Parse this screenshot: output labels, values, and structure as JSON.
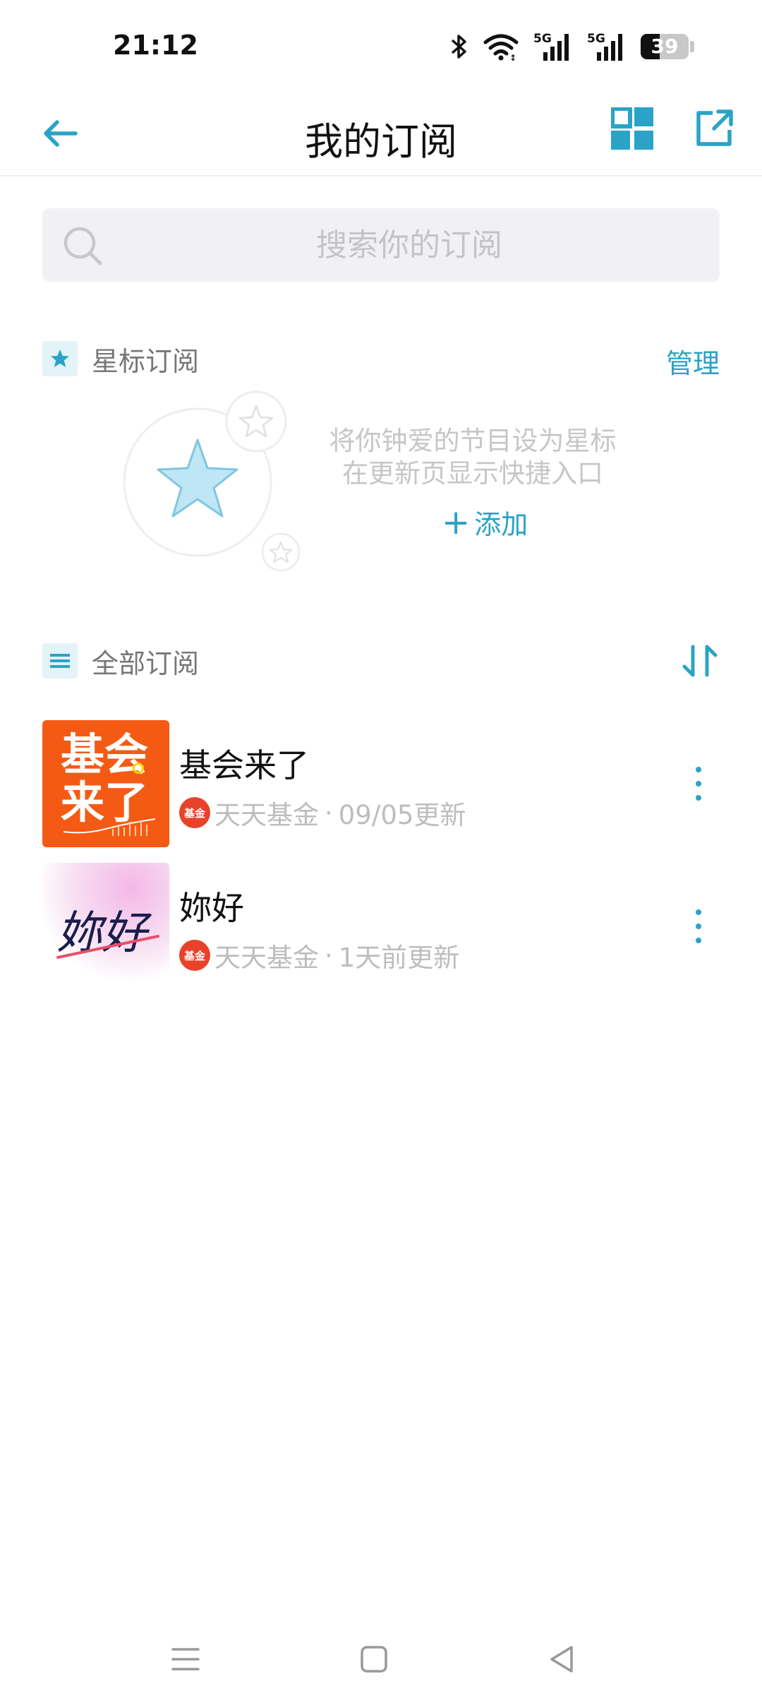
{
  "status_bar": {
    "time": "21:12",
    "network_1": "5G",
    "network_2": "5G",
    "battery_percent": 39,
    "battery_text": "39"
  },
  "header": {
    "title": "我的订阅",
    "back_icon": "arrow-left-icon",
    "grid_icon": "grid-view-icon",
    "share_icon": "external-link-icon"
  },
  "search": {
    "placeholder": "搜索你的订阅",
    "value": ""
  },
  "starred": {
    "title": "星标订阅",
    "action": "管理",
    "empty_line_1": "将你钟爱的节目设为星标",
    "empty_line_2": "在更新页显示快捷入口",
    "add_label": "添加",
    "add_symbol": "+"
  },
  "all": {
    "title": "全部订阅",
    "sort_icon": "sort-icon",
    "items": [
      {
        "title": "基会来了",
        "thumb_line_1": "基会",
        "thumb_line_2": "来了",
        "author_badge": "基金",
        "author": "天天基金",
        "separator": "·",
        "updated": "09/05更新"
      },
      {
        "title": "妳好",
        "thumb_text": "妳好",
        "author_badge": "基金",
        "author": "天天基金",
        "separator": "·",
        "updated": "1天前更新"
      }
    ]
  },
  "colors": {
    "accent": "#2ba3c6",
    "orange_thumb": "#f55a14",
    "badge_red": "#e8432a"
  }
}
